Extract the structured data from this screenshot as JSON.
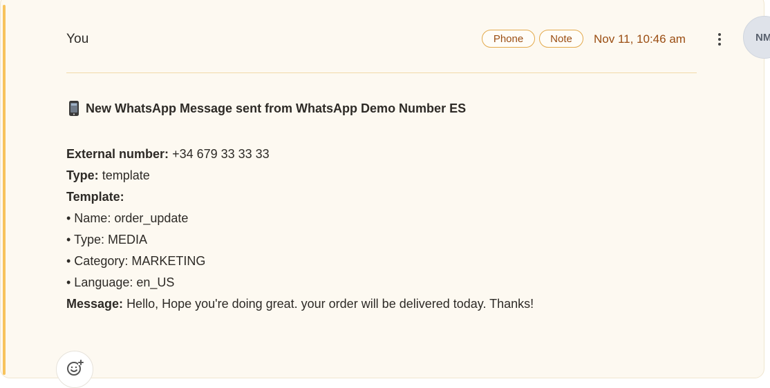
{
  "message": {
    "author": "You",
    "tags": [
      "Phone",
      "Note"
    ],
    "timestamp": "Nov 11, 10:46 am",
    "avatar_initials": "NM",
    "heading": "New WhatsApp Message sent from WhatsApp Demo Number ES",
    "heading_icon": "mobile-phone-icon",
    "fields": {
      "external_number_label": "External number:",
      "external_number_value": "+34 679 33 33 33",
      "type_label": "Type:",
      "type_value": "template",
      "template_label": "Template:",
      "template_items": [
        "• Name: order_update",
        "• Type: MEDIA",
        "• Category: MARKETING",
        "• Language: en_US"
      ],
      "message_label": "Message:",
      "message_value": "Hello, Hope you're doing great. your order will be delivered today. Thanks!"
    }
  },
  "icons": {
    "more": "kebab-menu-icon",
    "reaction": "add-reaction-icon"
  },
  "colors": {
    "card_background": "#fdf9f1",
    "accent": "#f7c35c",
    "tag_text": "#9a4d12",
    "tag_border": "#e3a94b",
    "avatar_background": "#dfe3ea"
  }
}
